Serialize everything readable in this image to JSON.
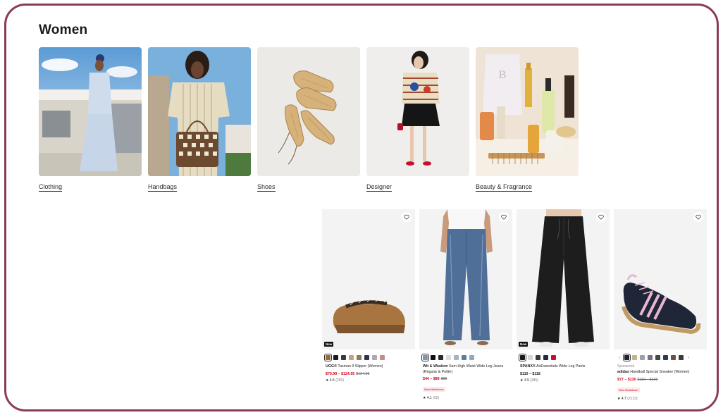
{
  "section": {
    "title": "Women"
  },
  "categories": [
    {
      "label": "Clothing"
    },
    {
      "label": "Handbags"
    },
    {
      "label": "Shoes"
    },
    {
      "label": "Designer"
    },
    {
      "label": "Beauty & Fragrance"
    }
  ],
  "products": [
    {
      "badge": "New",
      "brand": "UGG®",
      "name": "Tasman II Slipper (Women)",
      "price_sale": "$79.99 – $124.95",
      "price_orig": "$124.95",
      "rating": "4.5",
      "reviews": "(250)",
      "swatches": [
        "#9a6b3a",
        "#1b1b1b",
        "#3a3a3a",
        "#c2a284",
        "#8d7a57",
        "#2e3550",
        "#b3a7b3",
        "#c98b85"
      ]
    },
    {
      "brand": "Wit & Wisdom",
      "name": "Sam High Waist Wide Leg Jeans (Regular & Petite)",
      "price_sale": "$44 – $88",
      "price_orig": "$88",
      "markdown": "New Markdown",
      "rating": "4.1",
      "reviews": "(92)",
      "swatches": [
        "#7d96b3",
        "#111111",
        "#2a2a2a",
        "#dcdcdc",
        "#a9b3bd",
        "#5f7f99",
        "#8fa9bd"
      ]
    },
    {
      "badge": "New",
      "brand": "SPANX®",
      "name": "AirEssentials Wide Leg Pants",
      "price_regular": "$110 – $118",
      "rating": "3.9",
      "reviews": "(285)",
      "swatches": [
        "#1a1a1a",
        "#d9d4cd",
        "#3a3a3a",
        "#1f2a44",
        "#c8102e"
      ]
    },
    {
      "sponsored": "Sponsored",
      "brand": "adidas",
      "name": "Handball Special Sneaker (Women)",
      "price_sale": "$77 – $130",
      "price_orig": "$110 – $130",
      "markdown": "New Markdown",
      "rating": "4.7",
      "reviews": "(2123)",
      "swatches": [
        "#1d2333",
        "#c4b48a",
        "#9aa2ac",
        "#7e6f8a",
        "#404a3e",
        "#2e3a5c",
        "#6b5043",
        "#3b3b3b"
      ]
    }
  ],
  "colors": {
    "frame": "#8b3a5a",
    "sale": "#d0021b"
  }
}
